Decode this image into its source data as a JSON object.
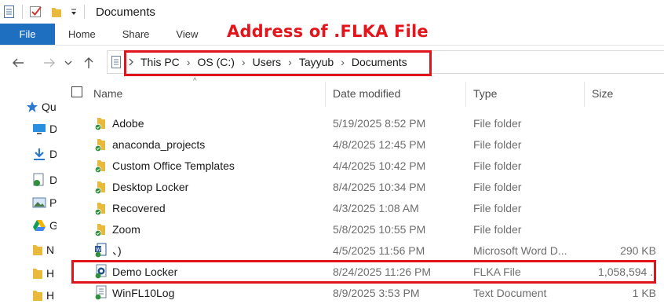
{
  "window": {
    "title": "Documents"
  },
  "ribbon": {
    "file": "File",
    "tabs": [
      "Home",
      "Share",
      "View"
    ]
  },
  "annotation": {
    "text": "Address of .FLKA File",
    "color": "#e4141b"
  },
  "nav": {
    "back_icon": "arrow-left-icon",
    "forward_icon": "arrow-right-icon",
    "recent_icon": "chevron-down-icon",
    "up_icon": "arrow-up-icon"
  },
  "breadcrumb": [
    "This PC",
    "OS (C:)",
    "Users",
    "Tayyub",
    "Documents"
  ],
  "navpane": {
    "items": [
      {
        "label": "Qu",
        "icon": "star-icon"
      },
      {
        "label": "D",
        "icon": "desktop-icon"
      },
      {
        "label": "D",
        "icon": "download-icon"
      },
      {
        "label": "D",
        "icon": "document-icon"
      },
      {
        "label": "P",
        "icon": "pictures-icon"
      },
      {
        "label": "G",
        "icon": "drive-icon"
      },
      {
        "label": "N",
        "icon": "folder-icon"
      },
      {
        "label": "H",
        "icon": "folder-icon"
      },
      {
        "label": "H",
        "icon": "folder-icon"
      }
    ]
  },
  "columns": {
    "name": "Name",
    "date": "Date modified",
    "type": "Type",
    "size": "Size"
  },
  "files": [
    {
      "name": "Adobe",
      "date": "5/19/2025 8:52 PM",
      "type": "File folder",
      "size": "",
      "icon": "folder-icon"
    },
    {
      "name": "anaconda_projects",
      "date": "4/8/2025 12:45 PM",
      "type": "File folder",
      "size": "",
      "icon": "folder-icon"
    },
    {
      "name": "Custom Office Templates",
      "date": "4/4/2025 10:42 PM",
      "type": "File folder",
      "size": "",
      "icon": "folder-icon"
    },
    {
      "name": "Desktop Locker",
      "date": "8/4/2025 10:34 PM",
      "type": "File folder",
      "size": "",
      "icon": "folder-icon"
    },
    {
      "name": "Recovered",
      "date": "4/3/2025 1:08 AM",
      "type": "File folder",
      "size": "",
      "icon": "folder-icon"
    },
    {
      "name": "Zoom",
      "date": "5/8/2025 10:55 PM",
      "type": "File folder",
      "size": "",
      "icon": "folder-icon"
    },
    {
      "name": "、)",
      "date": "4/5/2025 11:56 PM",
      "type": "Microsoft Word D...",
      "size": "290 KB",
      "icon": "word-doc-icon"
    },
    {
      "name": "Demo Locker",
      "date": "8/24/2025 11:26 PM",
      "type": "FLKA File",
      "size": "1,058,594 ..",
      "icon": "flka-file-icon"
    },
    {
      "name": "WinFL10Log",
      "date": "8/9/2025 3:53 PM",
      "type": "Text Document",
      "size": "1 KB",
      "icon": "text-file-icon"
    }
  ],
  "colors": {
    "accent": "#1f6fc1",
    "highlight": "#e0141b",
    "folder": "#e8b93b",
    "sync": "#2f8f3a"
  }
}
